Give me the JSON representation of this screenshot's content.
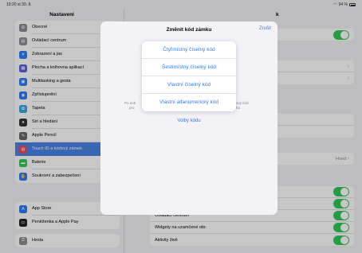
{
  "status": {
    "time": "19:20  st 30. 8.",
    "battery": "94 %"
  },
  "sidebar": {
    "title": "Nastavení",
    "groups": [
      [
        {
          "label": "Obecné",
          "icon": "gear-icon",
          "color": "#8e8e93",
          "glyph": "⚙"
        },
        {
          "label": "Ovládací centrum",
          "icon": "control-center-icon",
          "color": "#8e8e93",
          "glyph": "▤"
        },
        {
          "label": "Zobrazení a jas",
          "icon": "brightness-icon",
          "color": "#2f7cf6",
          "glyph": "☀"
        },
        {
          "label": "Plocha a knihovna aplikací",
          "icon": "home-screen-icon",
          "color": "#5b5fe0",
          "glyph": "▦"
        },
        {
          "label": "Multitasking a gesta",
          "icon": "multitasking-icon",
          "color": "#2f7cf6",
          "glyph": "▣"
        },
        {
          "label": "Zpřístupnění",
          "icon": "accessibility-icon",
          "color": "#2f7cf6",
          "glyph": "◉"
        },
        {
          "label": "Tapeta",
          "icon": "wallpaper-icon",
          "color": "#3aa7e8",
          "glyph": "✿"
        },
        {
          "label": "Siri a hledání",
          "icon": "siri-icon",
          "color": "#333333",
          "glyph": "●"
        },
        {
          "label": "Apple Pencil",
          "icon": "pencil-icon",
          "color": "#666666",
          "glyph": "✎"
        },
        {
          "label": "Touch ID a kódový zámek",
          "icon": "fingerprint-icon",
          "color": "#f0485a",
          "glyph": "◍"
        },
        {
          "label": "Baterie",
          "icon": "battery-icon",
          "color": "#34c759",
          "glyph": "▬"
        },
        {
          "label": "Soukromí a zabezpečení",
          "icon": "privacy-hand-icon",
          "color": "#2f7cf6",
          "glyph": "✋"
        }
      ],
      [
        {
          "label": "App Store",
          "icon": "app-store-icon",
          "color": "#2f7cf6",
          "glyph": "A"
        },
        {
          "label": "Peněženka a Apple Pay",
          "icon": "wallet-icon",
          "color": "#222222",
          "glyph": "▭"
        }
      ],
      [
        {
          "label": "Hesla",
          "icon": "key-icon",
          "color": "#8e8e93",
          "glyph": "⚿"
        }
      ]
    ],
    "selected_index": 9
  },
  "detail": {
    "header_fragment": "k",
    "rows_bottom": [
      {
        "label": "Ovládací centrum"
      },
      {
        "label": "Widgety na uzamčené obr."
      },
      {
        "label": "Aktivity živě"
      }
    ],
    "value_text": "Hned"
  },
  "modal": {
    "title": "Změnit kód zámku",
    "cancel": "Zrušit",
    "hint_left": "Po dob",
    "hint_left2": "pro",
    "hint_right": "ový kód",
    "hint_right2": "ho",
    "options_link": "Volby kódu"
  },
  "popover": {
    "items": [
      "Čtyřmístný číselný kód",
      "Šestimístný číselný kód",
      "Vlastní číselný kód",
      "Vlastní alfanumerický kód"
    ]
  },
  "colors": {
    "accent": "#2f7cf6",
    "toggle_on": "#34c759",
    "selected_row": "#4a83e6"
  }
}
